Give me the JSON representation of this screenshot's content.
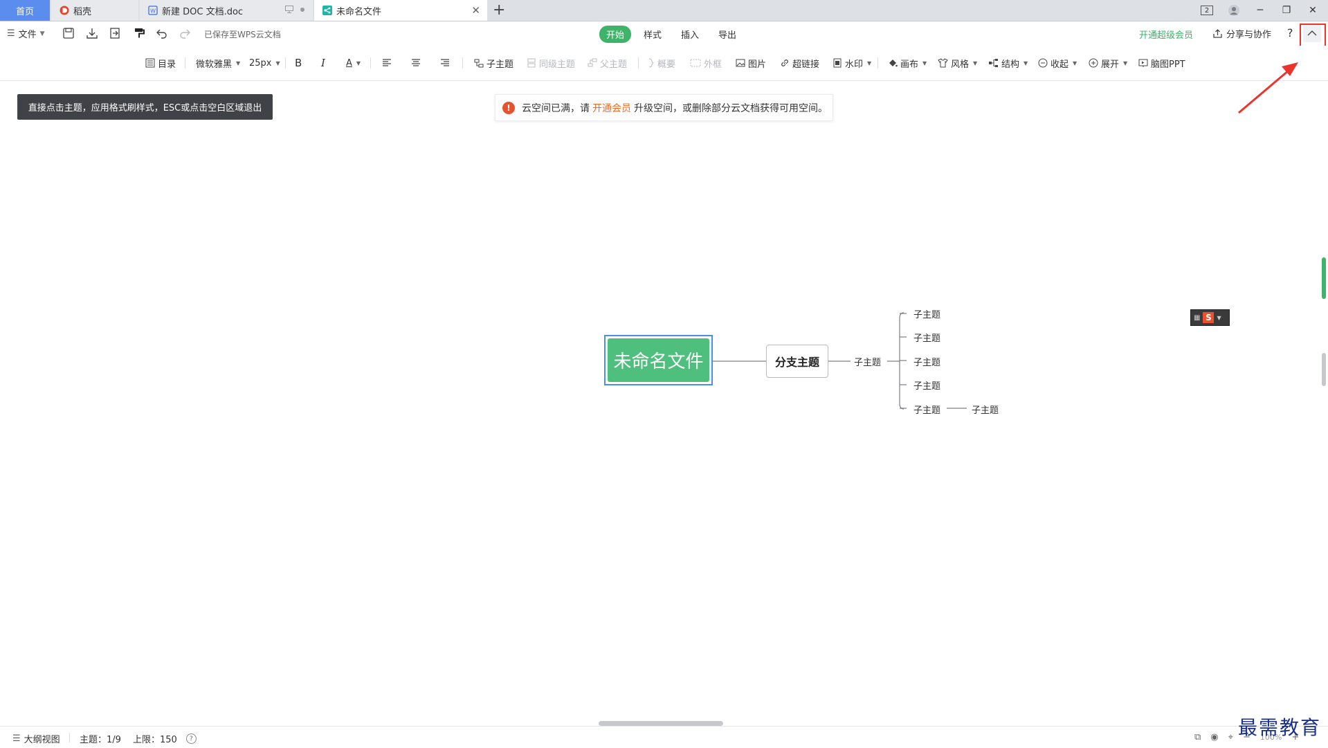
{
  "tabs": {
    "home": "首页",
    "daoke": "稻壳",
    "doc": "新建 DOC 文档.doc",
    "active": "未命名文件",
    "add": "+",
    "badge": "2"
  },
  "menu": {
    "file": "文件",
    "save_status": "已保存至WPS云文档",
    "center_tabs": [
      "开始",
      "样式",
      "插入",
      "导出"
    ],
    "vip": "开通超级会员",
    "share": "分享与协作",
    "help": "?"
  },
  "ribbon": {
    "outline": "目录",
    "font": "微软雅黑",
    "size": "25px",
    "bold": "B",
    "italic": "I",
    "font_color": "A",
    "child_topic": "子主题",
    "sibling_topic": "同级主题",
    "parent_topic": "父主题",
    "summary": "概要",
    "frame": "外框",
    "image": "图片",
    "hyperlink": "超链接",
    "watermark": "水印",
    "canvas": "画布",
    "style": "风格",
    "structure": "结构",
    "collapse": "收起",
    "expand": "展开",
    "ppt": "脑图PPT"
  },
  "canvas": {
    "tooltip": "直接点击主题，应用格式刷样式，ESC或点击空白区域退出",
    "notice_before": "云空间已满，请",
    "notice_link": "开通会员",
    "notice_after": "升级空间，或删除部分云文档获得可用空间。",
    "root": "未命名文件",
    "branch": "分支主题",
    "level2": "子主题",
    "level3": [
      "子主题",
      "子主题",
      "子主题",
      "子主题",
      "子主题"
    ],
    "level4": "子主题"
  },
  "status": {
    "outline_view": "大纲视图",
    "topics": "主题：1/9",
    "limit": "上限：150",
    "zoom": "100%"
  },
  "watermark_text": "最需教育",
  "colors": {
    "accent_green": "#3fb36a",
    "root_green": "#4fbf7e",
    "home_blue": "#5b8def",
    "highlight_red": "#e8362e",
    "link_orange": "#f06a1d"
  }
}
